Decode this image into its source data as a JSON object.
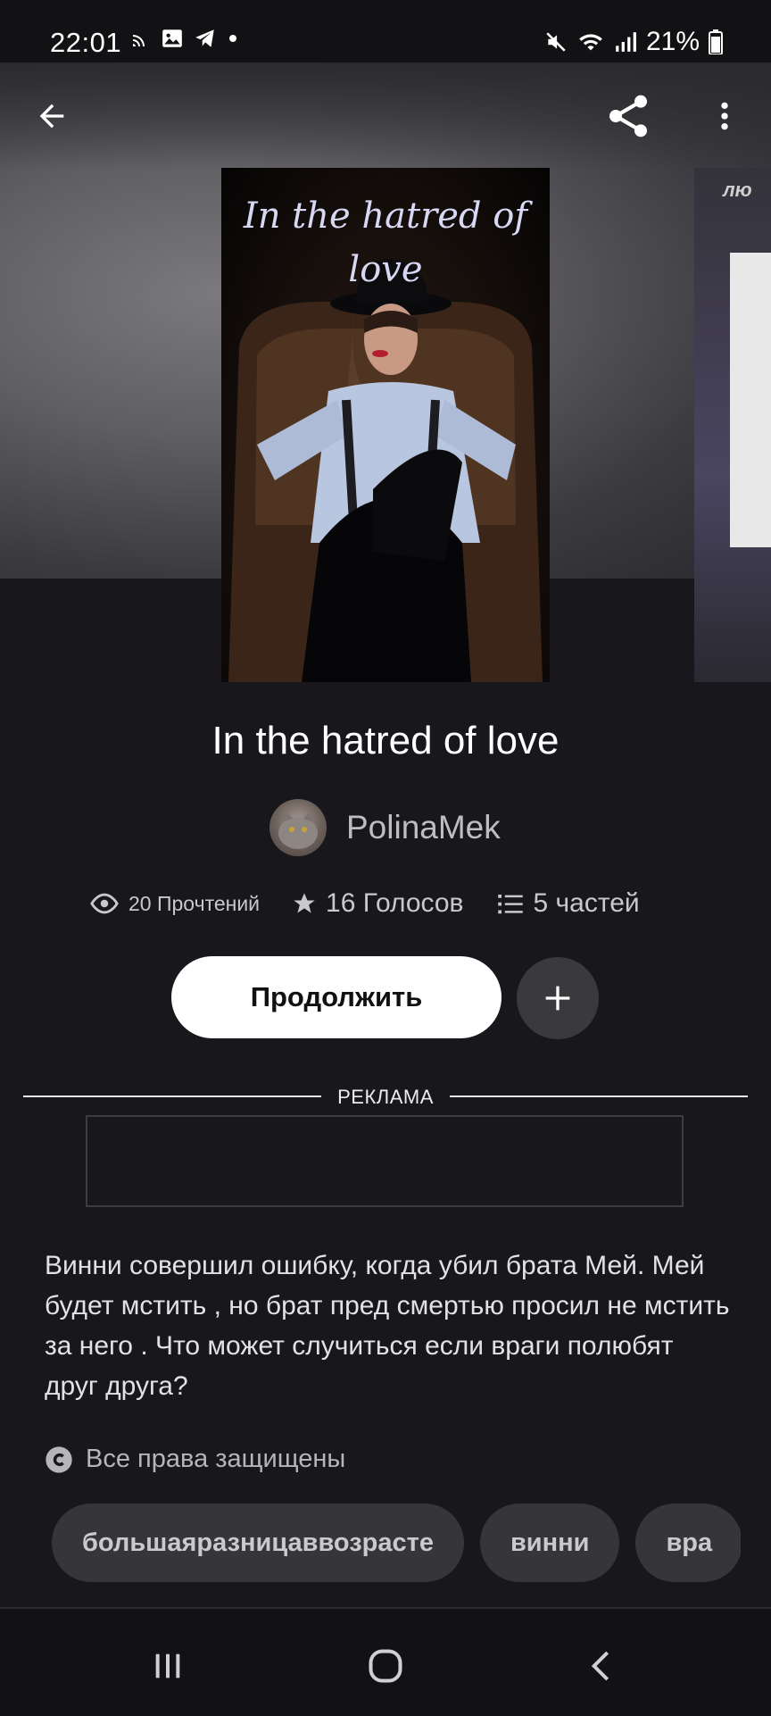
{
  "status_bar": {
    "time": "22:01",
    "battery": "21%",
    "left_icons": [
      "cast-icon",
      "gallery-icon",
      "telegram-icon",
      "dot-icon"
    ],
    "right_icons": [
      "mute-icon",
      "wifi-icon",
      "signal-icon",
      "battery-icon"
    ]
  },
  "toolbar": {
    "icons": [
      "back-arrow-icon",
      "share-icon",
      "more-vertical-icon"
    ]
  },
  "cover": {
    "title_line1": "In the hatred of",
    "title_line2": "love",
    "next_cover_text": "лю"
  },
  "book": {
    "title": "In the hatred of love",
    "author": "PolinaMek"
  },
  "stats": {
    "reads": "20 Прочтений",
    "votes": "16 Голосов",
    "parts": "5 частей"
  },
  "actions": {
    "continue_label": "Продолжить",
    "add_icon": "plus-icon"
  },
  "ad": {
    "label": "РЕКЛАМА"
  },
  "description": "Винни совершил ошибку, когда убил брата Мей. Мей будет мстить , но брат пред смертью просил не мстить за него . Что может случиться если враги полюбят друг друга?",
  "rights": "Все права защищены",
  "tags": [
    "большаяразницаввозрасте",
    "винни",
    "вра"
  ],
  "colors": {
    "background": "#18171c",
    "button_primary": "#ffffff",
    "tag_background": "#36363a"
  }
}
